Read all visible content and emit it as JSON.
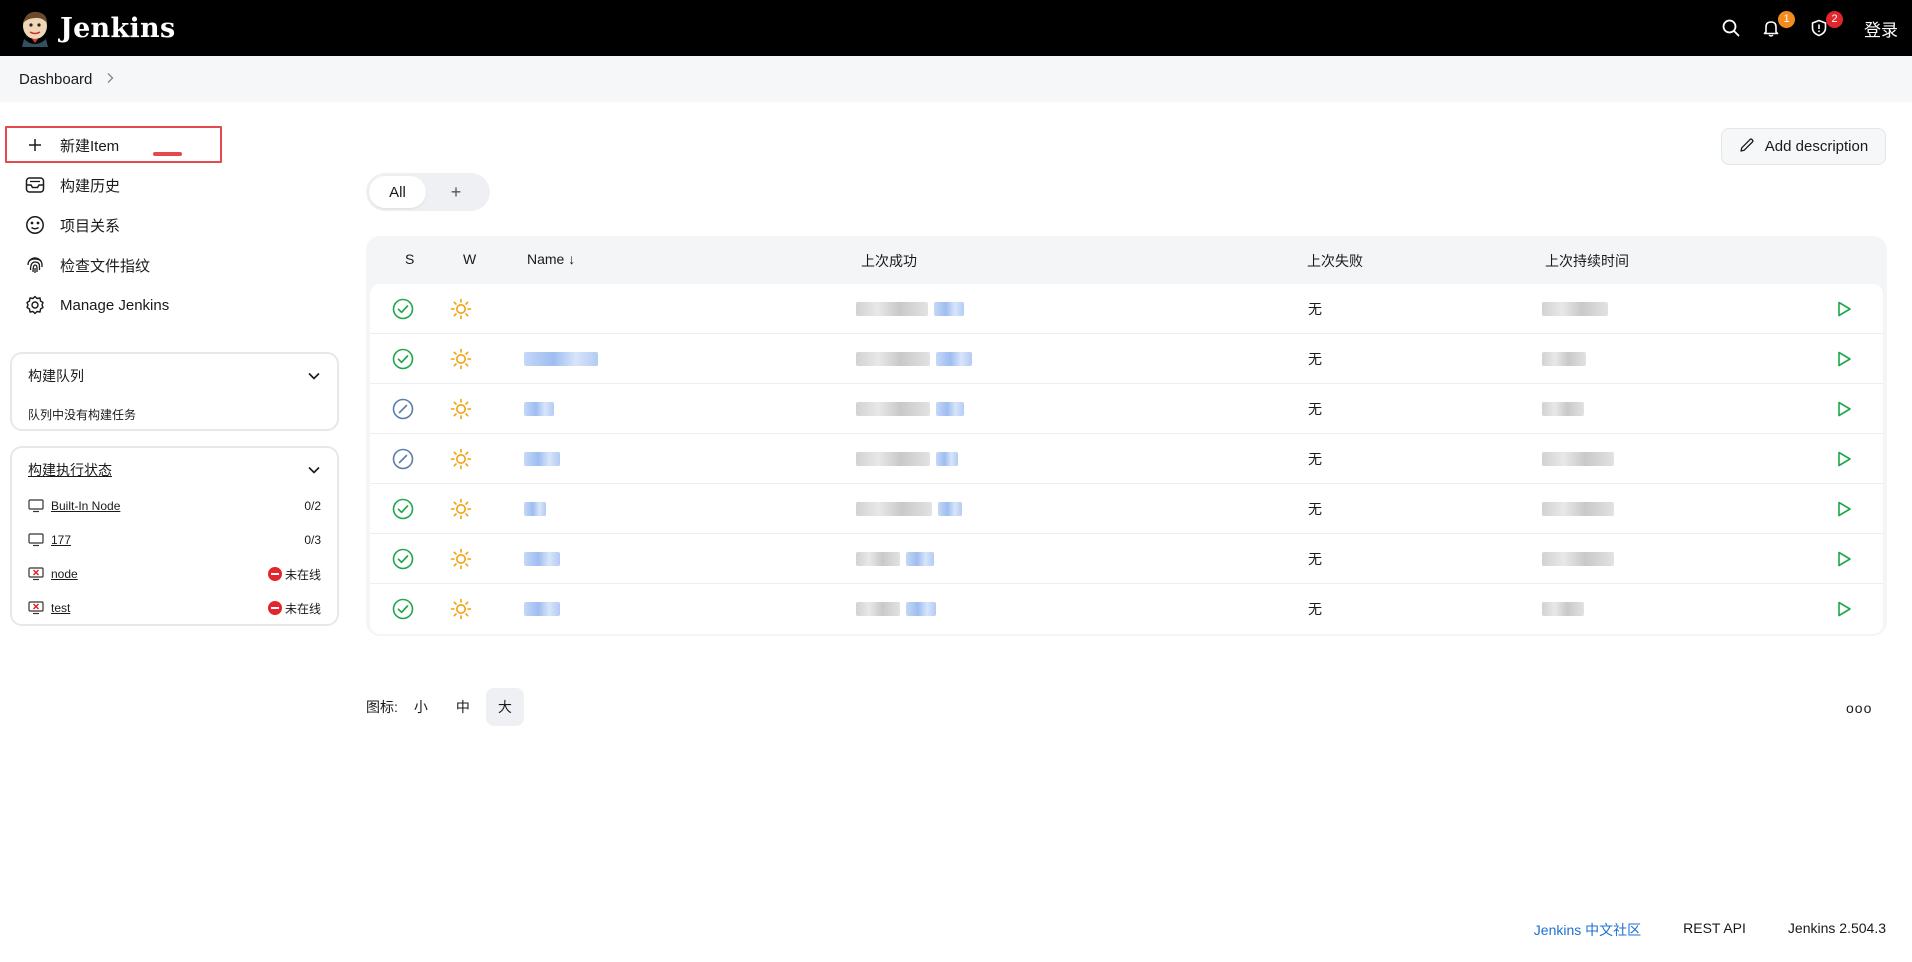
{
  "header": {
    "title": "Jenkins",
    "notifications_count": "1",
    "security_count": "2",
    "login_label": "登录",
    "colors": {
      "bg": "#000000",
      "notif_badge": "#f48b1e",
      "security_badge": "#e1262d"
    }
  },
  "breadcrumb": {
    "items": [
      "Dashboard"
    ]
  },
  "sidebar": {
    "tasks": [
      {
        "label": "新建Item",
        "icon": "plus-icon"
      },
      {
        "label": "构建历史",
        "icon": "inbox-icon"
      },
      {
        "label": "项目关系",
        "icon": "relationship-icon"
      },
      {
        "label": "检查文件指纹",
        "icon": "fingerprint-icon"
      },
      {
        "label": "Manage Jenkins",
        "icon": "gear-icon"
      }
    ],
    "build_queue": {
      "title": "构建队列",
      "empty_text": "队列中没有构建任务"
    },
    "executors": {
      "title": "构建执行状态",
      "nodes": [
        {
          "name": "Built-In Node",
          "status": "0/2",
          "offline": false
        },
        {
          "name": "177",
          "status": "0/3",
          "offline": false
        },
        {
          "name": "node",
          "status": "未在线",
          "offline": true
        },
        {
          "name": "test",
          "status": "未在线",
          "offline": true
        }
      ]
    }
  },
  "main": {
    "add_description_label": "Add description",
    "tabs": {
      "all_label": "All",
      "add_label": "+"
    },
    "table": {
      "headers": {
        "s": "S",
        "w": "W",
        "name": "Name ↓",
        "last_success": "上次成功",
        "last_failure": "上次失败",
        "last_duration": "上次持续时间"
      },
      "rows": [
        {
          "status": "success",
          "last_failure": "无"
        },
        {
          "status": "success",
          "last_failure": "无"
        },
        {
          "status": "not-built",
          "last_failure": "无"
        },
        {
          "status": "not-built",
          "last_failure": "无"
        },
        {
          "status": "success",
          "last_failure": "无"
        },
        {
          "status": "success",
          "last_failure": "无"
        },
        {
          "status": "success",
          "last_failure": "无"
        }
      ]
    },
    "icon_size": {
      "label": "图标:",
      "options": [
        "小",
        "中",
        "大"
      ],
      "selected": "大"
    },
    "more_label": "ooo"
  },
  "footer": {
    "community": "Jenkins 中文社区",
    "rest_api": "REST API",
    "version": "Jenkins 2.504.3"
  }
}
